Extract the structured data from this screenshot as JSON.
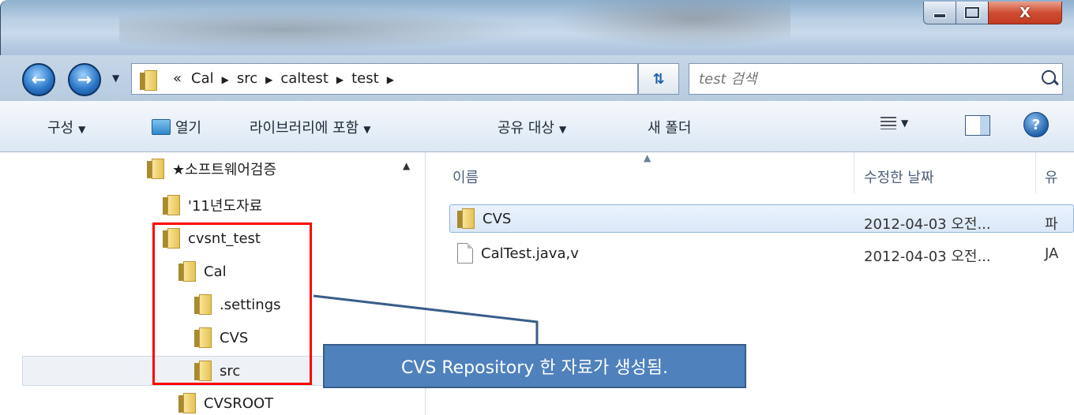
{
  "window": {
    "controls": {
      "minimize": "minimize",
      "maximize": "maximize",
      "close_label": "X"
    }
  },
  "nav": {
    "back_icon": "back-arrow-icon",
    "forward_icon": "forward-arrow-icon",
    "breadcrumb_overflow": "«",
    "breadcrumbs": [
      "Cal",
      "src",
      "caltest",
      "test"
    ],
    "search_placeholder": "test 검색"
  },
  "toolbar": {
    "organize": "구성",
    "open": "열기",
    "include_in_library": "라이브러리에 포함",
    "share_with": "공유 대상",
    "new_folder": "새 폴더",
    "help_label": "?"
  },
  "tree": {
    "items": [
      {
        "label": "★소프트웨어검증"
      },
      {
        "label": "'11년도자료"
      },
      {
        "label": "cvsnt_test"
      },
      {
        "label": "Cal"
      },
      {
        "label": ".settings"
      },
      {
        "label": "CVS"
      },
      {
        "label": "src"
      },
      {
        "label": "CVSROOT"
      }
    ]
  },
  "files": {
    "columns": {
      "name": "이름",
      "date": "수정한 날짜",
      "type": "유"
    },
    "rows": [
      {
        "name": "CVS",
        "date": "2012-04-03 오전...",
        "type": "파"
      },
      {
        "name": "CalTest.java,v",
        "date": "2012-04-03 오전...",
        "type": "JA"
      }
    ]
  },
  "annotation": {
    "callout_text": "CVS Repository 한 자료가 생성됨.",
    "box_color": "#ff0000",
    "callout_color": "#4f81bd"
  }
}
